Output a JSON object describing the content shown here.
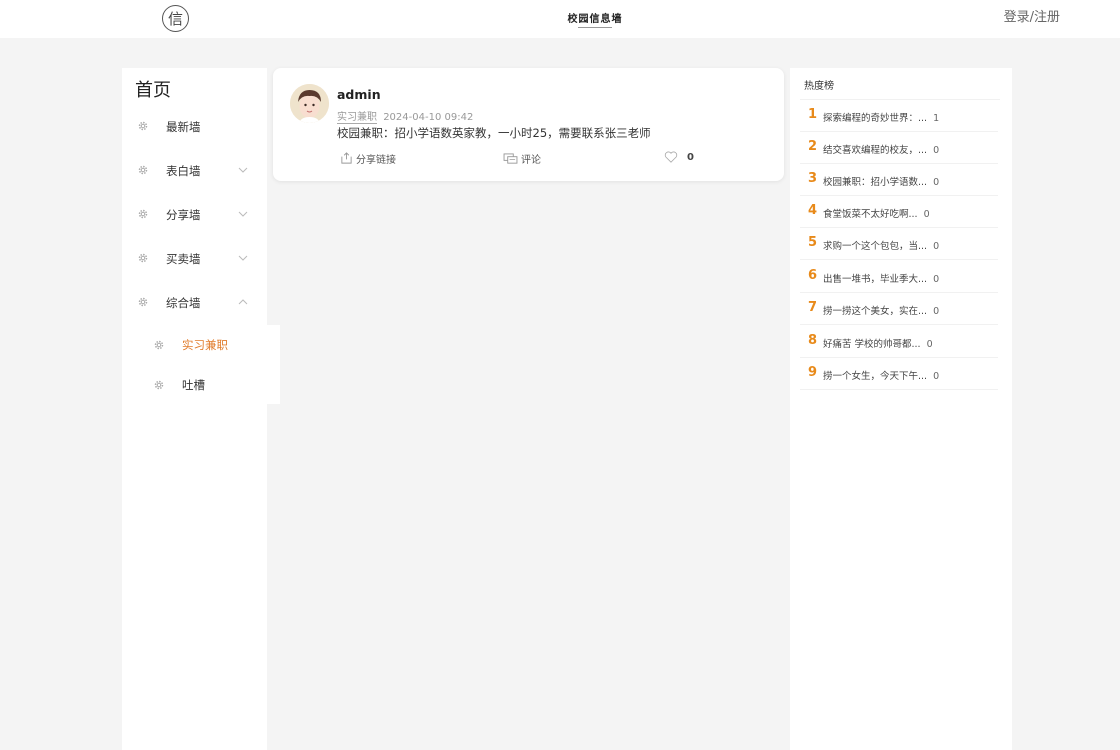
{
  "header": {
    "logo_glyph": "信",
    "brand_name": "校园信息墙",
    "auth_link": "登录/注册"
  },
  "sidebar": {
    "title": "首页",
    "items": [
      {
        "label": "最新墙",
        "expandable": false
      },
      {
        "label": "表白墙",
        "expandable": true,
        "expanded": false
      },
      {
        "label": "分享墙",
        "expandable": true,
        "expanded": false
      },
      {
        "label": "买卖墙",
        "expandable": true,
        "expanded": false
      },
      {
        "label": "综合墙",
        "expandable": true,
        "expanded": true
      }
    ],
    "subitems": [
      {
        "label": "实习兼职",
        "active": true
      },
      {
        "label": "吐槽",
        "active": false
      }
    ],
    "icons": {
      "menu": "gear-icon",
      "collapsed": "chevron-down-icon",
      "expanded": "chevron-up-icon"
    }
  },
  "post": {
    "author": "admin",
    "tag": "实习兼职",
    "time": "2024-04-10 09:42",
    "content": "校园兼职：招小学语数英家教，一小时25，需要联系张三老师",
    "share_label": "分享链接",
    "comment_label": "评论",
    "like_count": "0"
  },
  "hot": {
    "title": "热度榜",
    "items": [
      {
        "rank": "1",
        "text": "探索编程的奇妙世界：...",
        "count": "1"
      },
      {
        "rank": "2",
        "text": "结交喜欢编程的校友，...",
        "count": "0"
      },
      {
        "rank": "3",
        "text": "校园兼职：招小学语数...",
        "count": "0"
      },
      {
        "rank": "4",
        "text": "食堂饭菜不太好吃啊...",
        "count": "0"
      },
      {
        "rank": "5",
        "text": "求购一个这个包包，当...",
        "count": "0"
      },
      {
        "rank": "6",
        "text": "出售一堆书，毕业季大...",
        "count": "0"
      },
      {
        "rank": "7",
        "text": "捞一捞这个美女，实在...",
        "count": "0"
      },
      {
        "rank": "8",
        "text": "好痛苦 学校的帅哥都...",
        "count": "0"
      },
      {
        "rank": "9",
        "text": "捞一个女生，今天下午...",
        "count": "0"
      }
    ]
  },
  "colors": {
    "accent": "#e07b2a",
    "rank": "#e88a1a",
    "background": "#f4f4f4"
  }
}
